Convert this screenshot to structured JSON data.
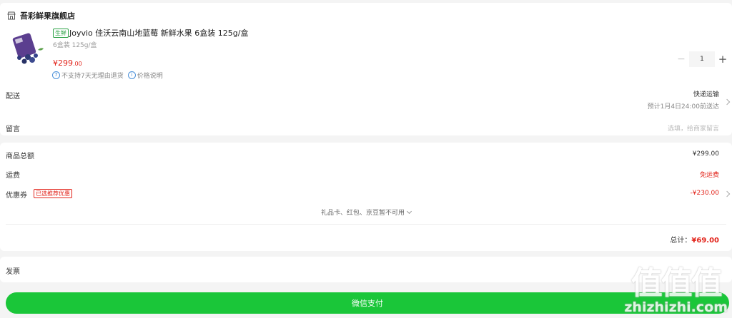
{
  "store": {
    "name": "吾彩鲜果旗舰店",
    "icon": "store-icon"
  },
  "product": {
    "tag": "生鲜",
    "title": "Joyvio 佳沃云南山地蓝莓 新鲜水果 6盒装 125g/盒",
    "spec": "6盒装 125g/盒",
    "price_int": "¥299",
    "price_dec": ".00",
    "quantity": "1",
    "note_no_return": "不支持7天无理由退货",
    "note_price": "价格说明"
  },
  "delivery": {
    "label": "配送",
    "method": "快递运输",
    "eta": "预计1月4日24:00前送达"
  },
  "message": {
    "label": "留言",
    "placeholder": "选填，给商家留言"
  },
  "summary": {
    "goods_label": "商品总额",
    "goods_value": "¥299.00",
    "shipping_label": "运费",
    "shipping_value": "免运费",
    "coupon_label": "优惠券",
    "coupon_badge": "已选推荐优惠",
    "coupon_value": "-¥230.00",
    "gift_note": "礼品卡、红包、京豆暂不可用",
    "total_label": "总计：",
    "total_value": "¥69.00"
  },
  "invoice": {
    "label": "发票"
  },
  "pay": {
    "label": "微信支付"
  },
  "watermark": {
    "logo": "值值值",
    "url": "zhizhizhi.com"
  },
  "colors": {
    "accent_red": "#e2231a",
    "pay_green": "#1ac639",
    "fresh_green": "#2ba245"
  }
}
